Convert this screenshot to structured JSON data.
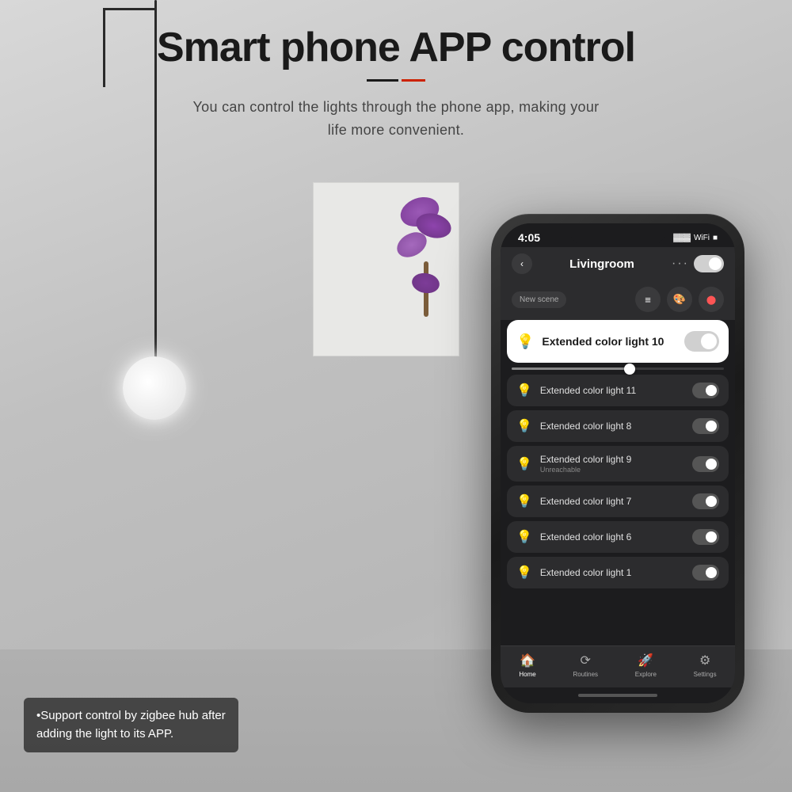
{
  "page": {
    "background_color": "#c8c8c8"
  },
  "header": {
    "title": "Smart phone APP control",
    "subtitle_line1": "You can control the lights through the phone app, making your",
    "subtitle_line2": "life more convenient."
  },
  "phone": {
    "status_bar": {
      "time": "4:05",
      "signal": "▓▓▓",
      "wifi": "WiFi",
      "battery": "■"
    },
    "app_header": {
      "back_icon": "‹",
      "room_name": "Livingroom",
      "dots": "···",
      "toggle_state": "off"
    },
    "toolbar": {
      "new_scene_label": "New scene",
      "icon1": "≡",
      "icon2": "🎨",
      "icon3": "⬤"
    },
    "featured_device": {
      "name": "Extended color light 10",
      "icon": "💡",
      "toggle": "off"
    },
    "devices": [
      {
        "name": "Extended color light 11",
        "status": "",
        "toggle": "off"
      },
      {
        "name": "Extended color light 8",
        "status": "",
        "toggle": "off"
      },
      {
        "name": "Extended color light 9",
        "status": "Unreachable",
        "toggle": "off"
      },
      {
        "name": "Extended color light 7",
        "status": "",
        "toggle": "off"
      },
      {
        "name": "Extended color light 6",
        "status": "",
        "toggle": "off"
      },
      {
        "name": "Extended color light 1",
        "status": "",
        "toggle": "off"
      }
    ],
    "bottom_nav": {
      "items": [
        {
          "icon": "🏠",
          "label": "Home",
          "active": true
        },
        {
          "icon": "⟳",
          "label": "Routines",
          "active": false
        },
        {
          "icon": "🚀",
          "label": "Explore",
          "active": false
        },
        {
          "icon": "⚙",
          "label": "Settings",
          "active": false
        }
      ]
    }
  },
  "support_text": {
    "line1": "•Support control by zigbee hub after",
    "line2": "adding the light to its APP."
  }
}
